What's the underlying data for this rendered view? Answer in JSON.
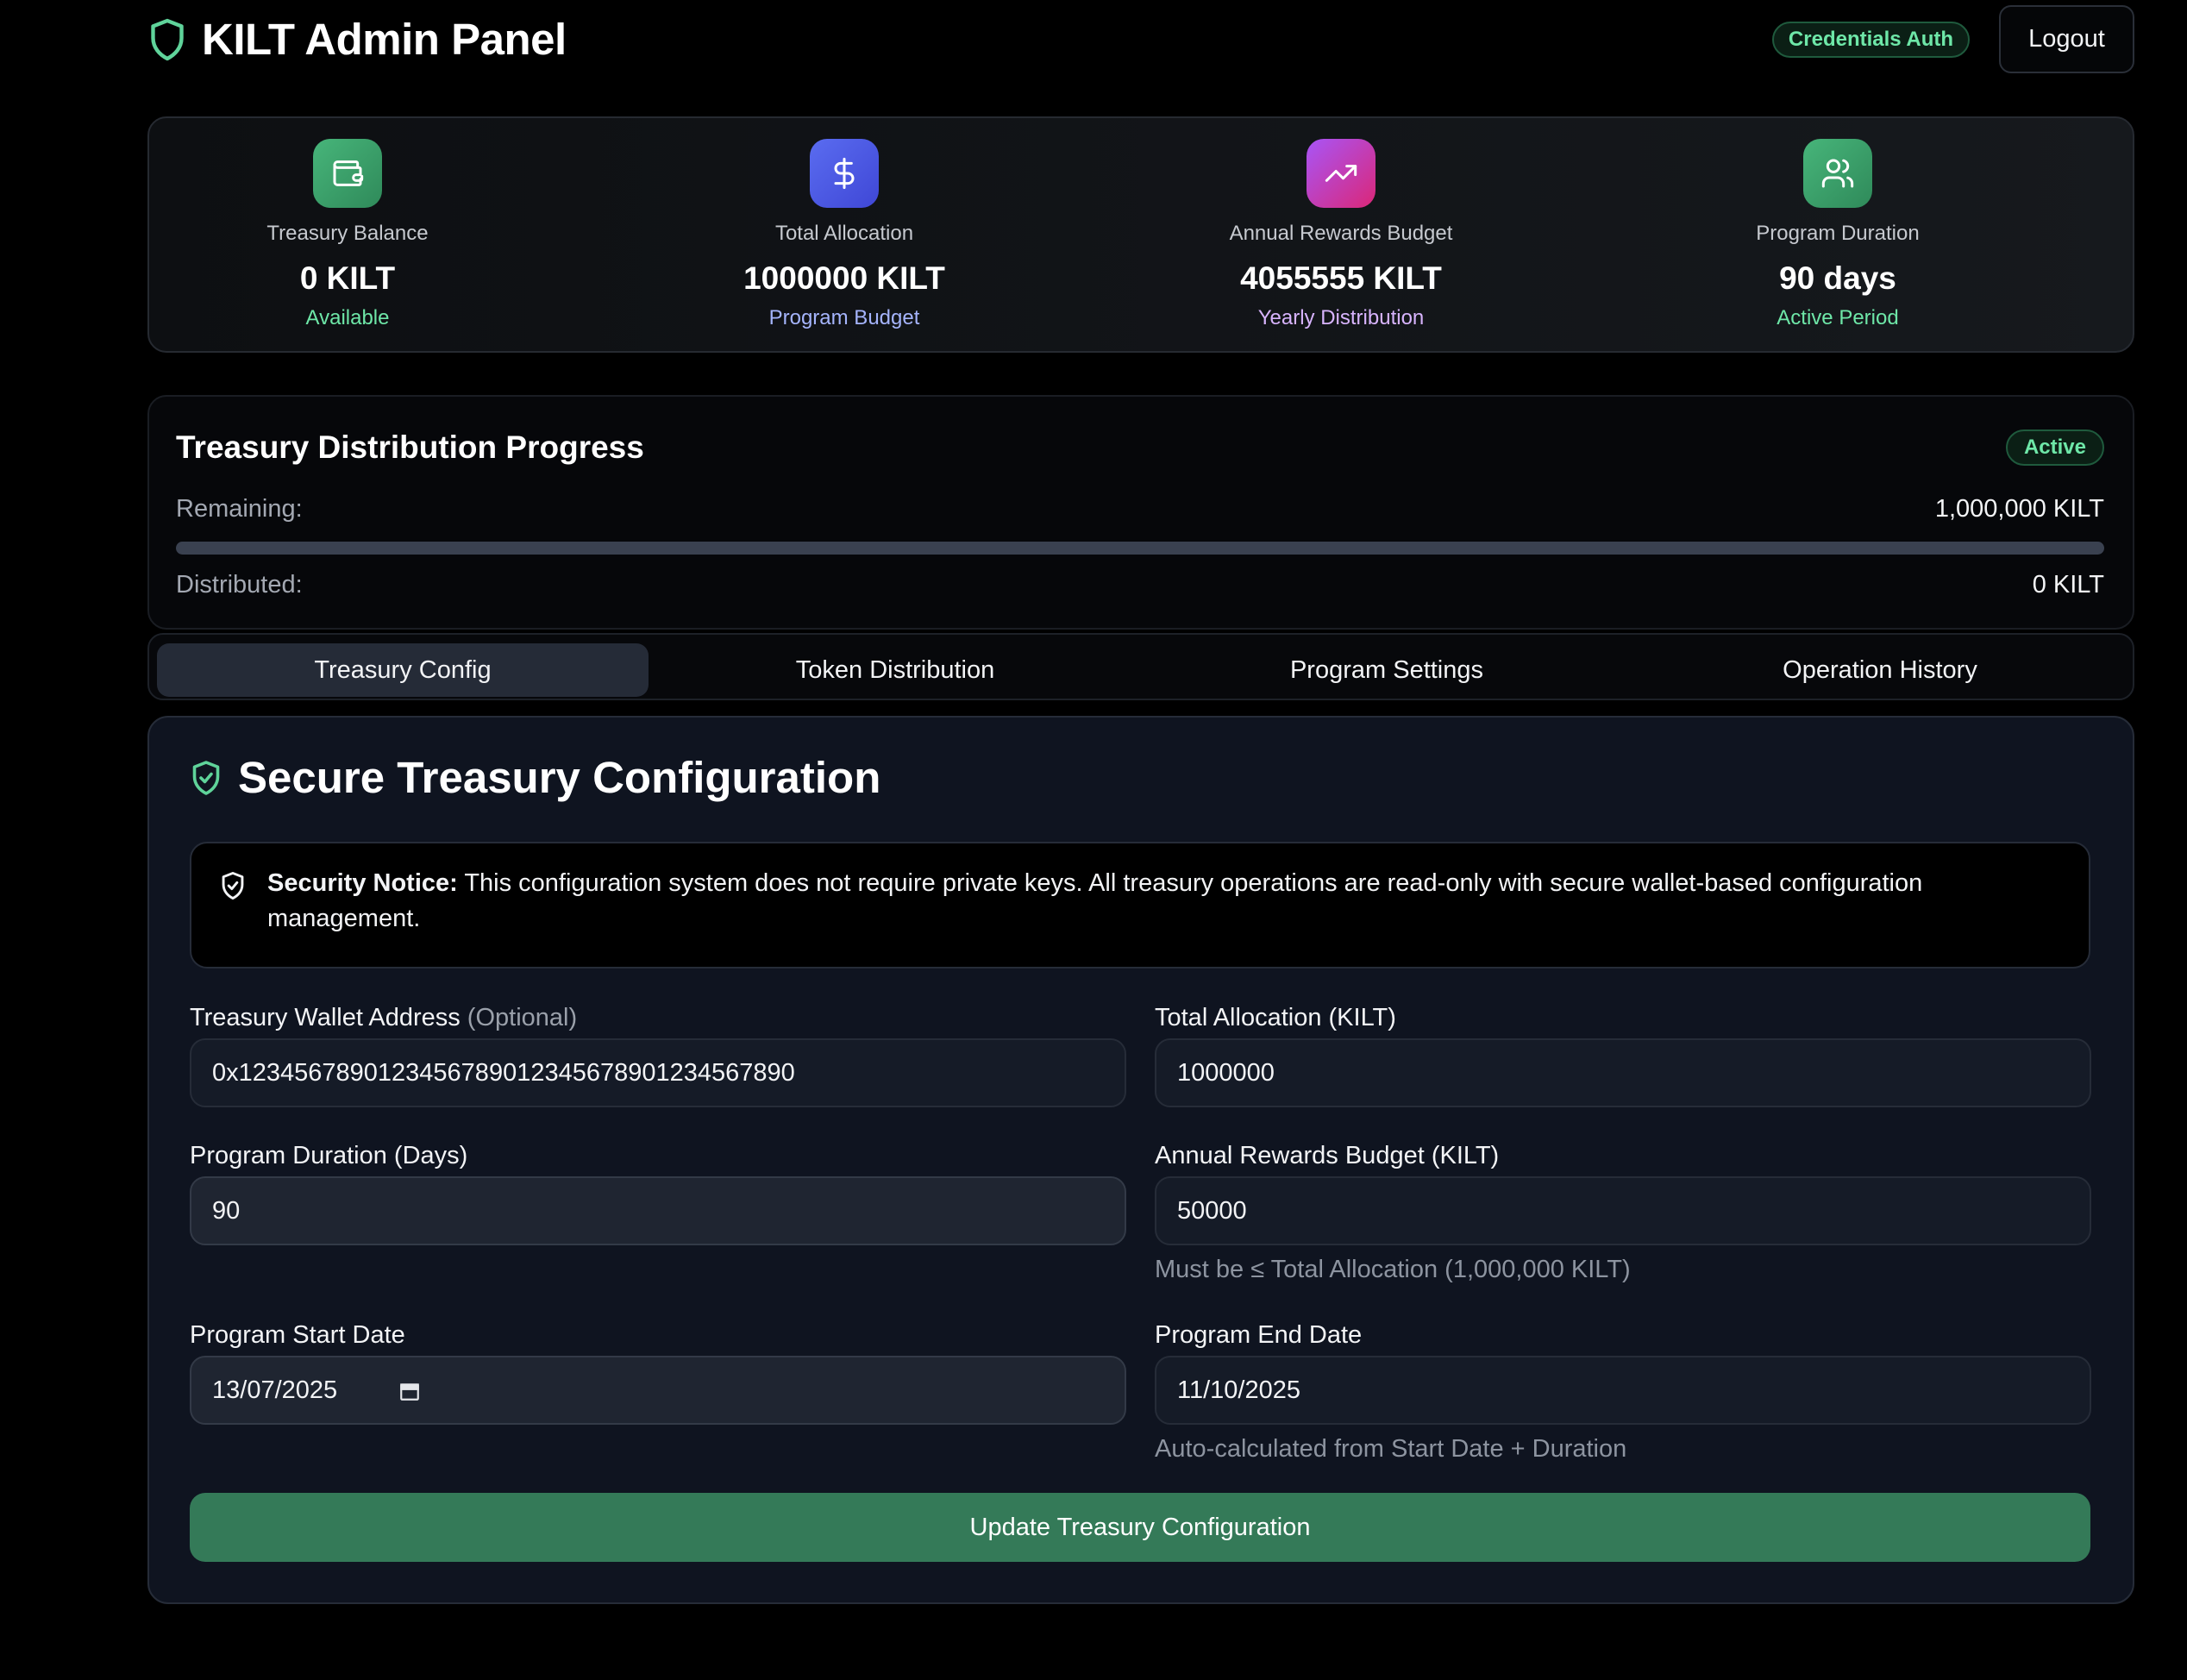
{
  "header": {
    "title": "KILT Admin Panel",
    "auth_badge": "Credentials Auth",
    "logout_label": "Logout"
  },
  "stats": [
    {
      "label": "Treasury Balance",
      "value": "0 KILT",
      "sub": "Available",
      "icon": "wallet-icon",
      "icon_color": "#3fa36b",
      "sub_color": "#6ee7a8"
    },
    {
      "label": "Total Allocation",
      "value": "1000000 KILT",
      "sub": "Program Budget",
      "icon": "dollar-icon",
      "icon_color": "#4f5ee8",
      "sub_color": "#a5b4fc"
    },
    {
      "label": "Annual Rewards Budget",
      "value": "4055555 KILT",
      "sub": "Yearly Distribution",
      "icon": "trending-up-icon",
      "icon_color": "#c044c6",
      "sub_color": "#d8b4fe"
    },
    {
      "label": "Program Duration",
      "value": "90 days",
      "sub": "Active Period",
      "icon": "users-icon",
      "icon_color": "#3fa36b",
      "sub_color": "#6ee7a8"
    }
  ],
  "progress": {
    "title": "Treasury Distribution Progress",
    "status": "Active",
    "remaining_label": "Remaining:",
    "remaining_value": "1,000,000 KILT",
    "distributed_label": "Distributed:",
    "distributed_value": "0 KILT",
    "distributed_fraction": 0
  },
  "tabs": [
    {
      "label": "Treasury Config",
      "active": true
    },
    {
      "label": "Token Distribution",
      "active": false
    },
    {
      "label": "Program Settings",
      "active": false
    },
    {
      "label": "Operation History",
      "active": false
    }
  ],
  "config": {
    "title": "Secure Treasury Configuration",
    "notice_strong": "Security Notice:",
    "notice_text": " This configuration system does not require private keys. All treasury operations are read-only with secure wallet-based configuration management.",
    "wallet_label": "Treasury Wallet Address",
    "wallet_optional": "(Optional)",
    "wallet_value": "0x1234567890123456789012345678901234567890",
    "allocation_label": "Total Allocation (KILT)",
    "allocation_value": "1000000",
    "duration_label": "Program Duration (Days)",
    "duration_value": "90",
    "rewards_label": "Annual Rewards Budget (KILT)",
    "rewards_value": "50000",
    "rewards_hint": "Must be ≤ Total Allocation (1,000,000 KILT)",
    "start_label": "Program Start Date",
    "start_value": "13/07/2025",
    "end_label": "Program End Date",
    "end_value": "11/10/2025",
    "end_hint": "Auto-calculated from Start Date + Duration",
    "submit_label": "Update Treasury Configuration"
  },
  "colors": {
    "accent_green": "#6ee7a8",
    "button_green": "#347a58",
    "background": "#000000",
    "card_bg": "#0f1420"
  }
}
